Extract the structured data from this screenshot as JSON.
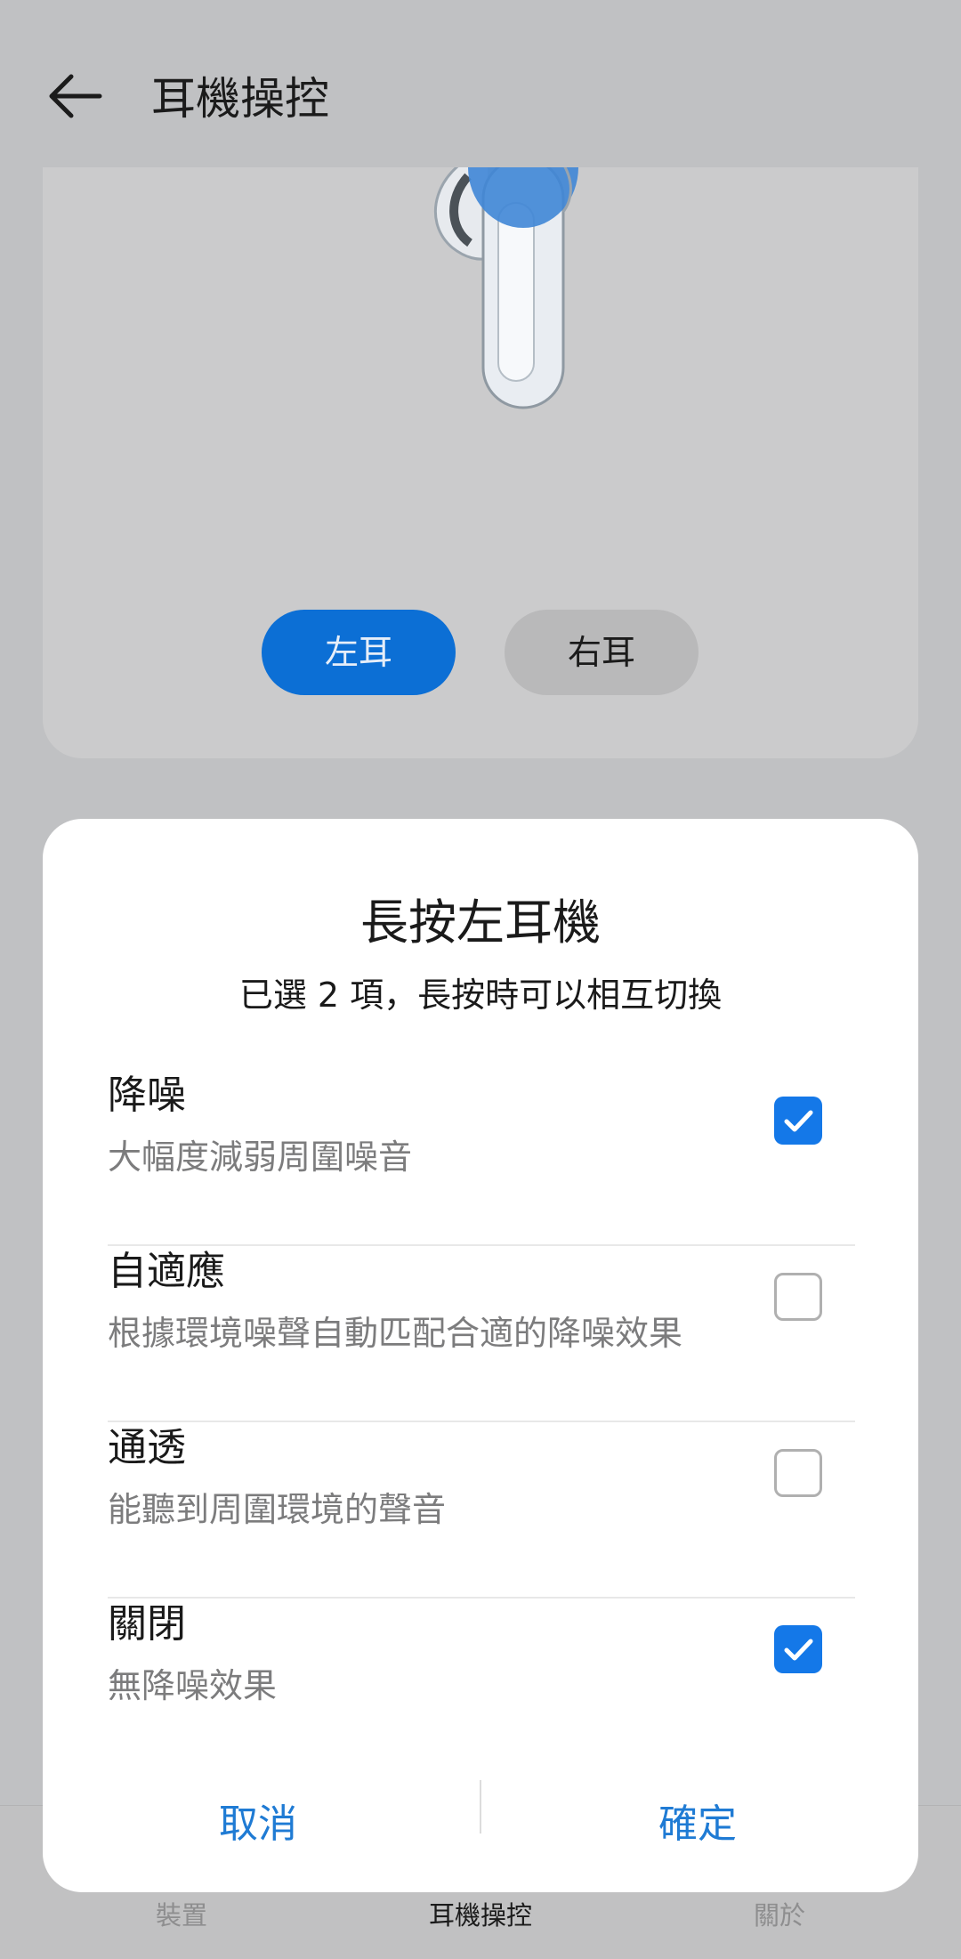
{
  "header": {
    "title": "耳機操控",
    "back_icon": "arrow-left-icon"
  },
  "ear_selector": {
    "left_label": "左耳",
    "right_label": "右耳",
    "selected": "左耳",
    "accent": "#0c6fd5"
  },
  "bottom_nav": {
    "items": [
      {
        "label": "裝置"
      },
      {
        "label": "耳機操控",
        "active": true
      },
      {
        "label": "關於"
      }
    ]
  },
  "dialog": {
    "title": "長按左耳機",
    "subtitle": "已選 2 項，長按時可以相互切換",
    "options": [
      {
        "name": "降噪",
        "desc": "大幅度減弱周圍噪音",
        "checked": true
      },
      {
        "name": "自適應",
        "desc": "根據環境噪聲自動匹配合適的降噪效果",
        "checked": false
      },
      {
        "name": "通透",
        "desc": "能聽到周圍環境的聲音",
        "checked": false
      },
      {
        "name": "關閉",
        "desc": "無降噪效果",
        "checked": true
      }
    ],
    "cancel_label": "取消",
    "confirm_label": "確定",
    "check_color": "#1478e8",
    "button_color": "#1f7bd4"
  }
}
